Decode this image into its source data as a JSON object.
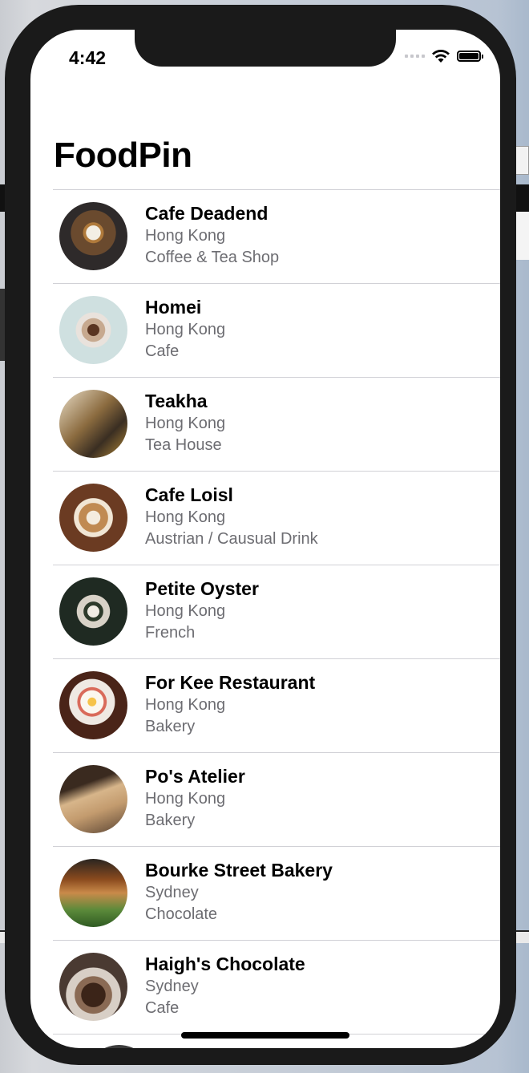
{
  "status_bar": {
    "time": "4:42"
  },
  "nav": {
    "title": "FoodPin"
  },
  "restaurants": [
    {
      "name": "Cafe Deadend",
      "location": "Hong Kong",
      "type": "Coffee & Tea Shop"
    },
    {
      "name": "Homei",
      "location": "Hong Kong",
      "type": "Cafe"
    },
    {
      "name": "Teakha",
      "location": "Hong Kong",
      "type": "Tea House"
    },
    {
      "name": "Cafe Loisl",
      "location": "Hong Kong",
      "type": "Austrian / Causual Drink"
    },
    {
      "name": "Petite Oyster",
      "location": "Hong Kong",
      "type": "French"
    },
    {
      "name": "For Kee Restaurant",
      "location": "Hong Kong",
      "type": "Bakery"
    },
    {
      "name": "Po's Atelier",
      "location": "Hong Kong",
      "type": "Bakery"
    },
    {
      "name": "Bourke Street Bakery",
      "location": "Sydney",
      "type": "Chocolate"
    },
    {
      "name": "Haigh's Chocolate",
      "location": "Sydney",
      "type": "Cafe"
    }
  ],
  "colors": {
    "primary_text": "#000000",
    "secondary_text": "#6d6d72",
    "separator": "#d1d1d6",
    "device_frame": "#1a1a1a"
  }
}
